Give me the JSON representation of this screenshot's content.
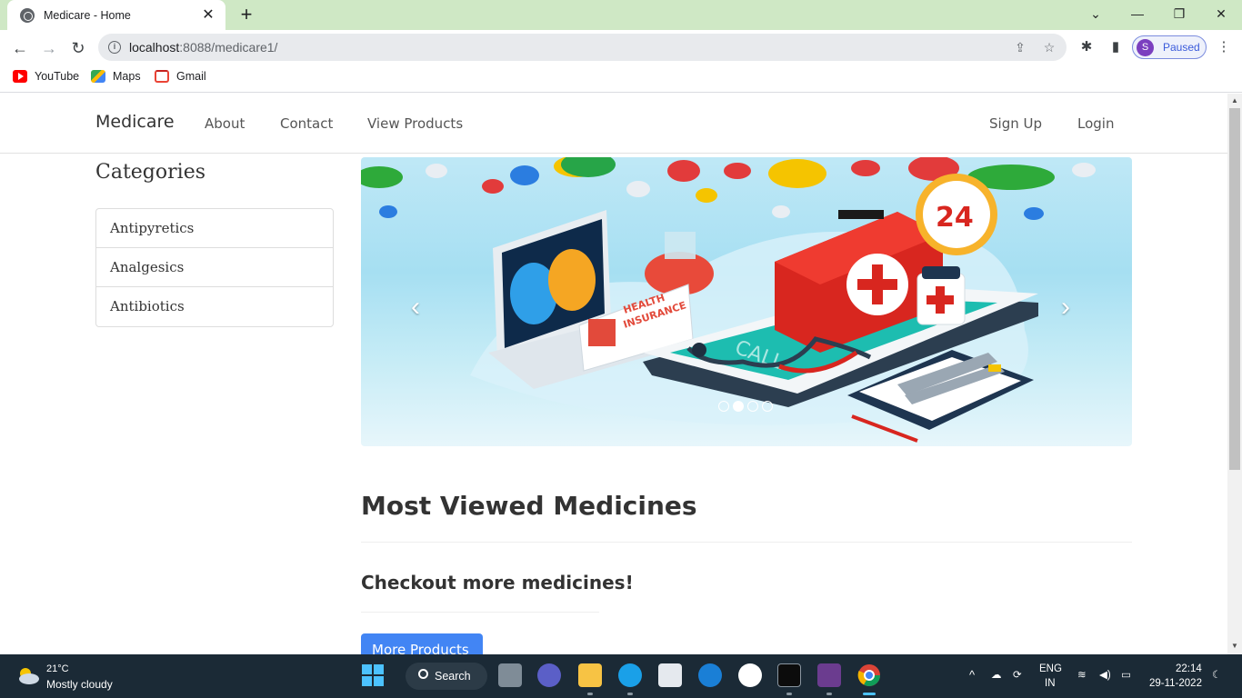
{
  "browser": {
    "tab_title": "Medicare - Home",
    "tab_close": "✕",
    "new_tab": "+",
    "window_controls": [
      "⌄",
      "—",
      "❐",
      "✕"
    ],
    "url_host": "localhost",
    "url_rest": ":8088/medicare1/",
    "profile_initial": "S",
    "profile_status": "Paused",
    "bookmarks": [
      {
        "label": "YouTube",
        "icon": "youtube-icon"
      },
      {
        "label": "Maps",
        "icon": "maps-icon"
      },
      {
        "label": "Gmail",
        "icon": "gmail-icon"
      }
    ]
  },
  "navbar": {
    "brand": "Medicare",
    "links": [
      "About",
      "Contact",
      "View Products"
    ],
    "right_links": [
      "Sign Up",
      "Login"
    ]
  },
  "sidebar": {
    "title": "Categories",
    "categories": [
      "Antipyretics",
      "Analgesics",
      "Antibiotics"
    ]
  },
  "carousel": {
    "prev": "‹",
    "next": "›",
    "slide_count": 4,
    "active_slide": 2,
    "badge_number": "24",
    "card_text_1": "HEALTH",
    "card_text_2": "INSURANCE",
    "phone_text": "CALL"
  },
  "main": {
    "most_viewed_title": "Most Viewed Medicines",
    "checkout_title": "Checkout more medicines!",
    "more_button": "More Products"
  },
  "taskbar": {
    "temperature": "21°C",
    "condition": "Mostly cloudy",
    "search_label": "Search",
    "lang_1": "ENG",
    "lang_2": "IN",
    "time": "22:14",
    "date": "29-11-2022"
  }
}
